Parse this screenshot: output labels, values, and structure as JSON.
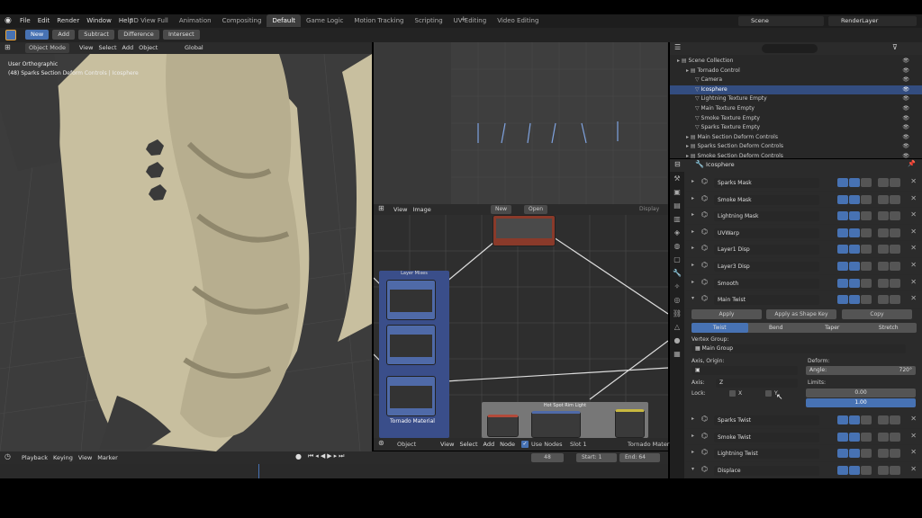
{
  "topbar": {
    "menus": [
      "File",
      "Edit",
      "Render",
      "Window",
      "Help"
    ],
    "workspaces": [
      "3D View Full",
      "Animation",
      "Compositing",
      "Default",
      "Game Logic",
      "Motion Tracking",
      "Scripting",
      "UV Editing",
      "Video Editing"
    ],
    "active_workspace": "Default",
    "scene": "Scene",
    "render_layer": "RenderLayer"
  },
  "toolbar": {
    "new": "New",
    "add": "Add",
    "subtract": "Subtract",
    "difference": "Difference",
    "intersect": "Intersect"
  },
  "viewport": {
    "mode": "Object Mode",
    "menus": [
      "View",
      "Select",
      "Add",
      "Object"
    ],
    "transform": "Global",
    "overlay_line1": "User Orthographic",
    "overlay_line2": "(48) Sparks Section Deform Controls | Icosphere"
  },
  "image_editor": {
    "menus": [
      "View",
      "Image"
    ],
    "new": "New",
    "open": "Open",
    "display": "Display"
  },
  "node_editor": {
    "object": "Object",
    "menus": [
      "View",
      "Select",
      "Add",
      "Node"
    ],
    "use_nodes": "Use Nodes",
    "slot": "Slot 1",
    "material": "Tornado Material",
    "frame_label": "Layer Mixes",
    "frame_label2": "Tornado Material",
    "frame_label3": "Hot Spot Rim Light"
  },
  "timeline": {
    "menus": [
      "Playback",
      "Keying",
      "View",
      "Marker"
    ],
    "frame": "48",
    "start_label": "Start:",
    "start": "1",
    "end_label": "End:",
    "end": "64"
  },
  "outliner": {
    "rows": [
      {
        "label": "Scene Collection",
        "indent": 0,
        "sel": false
      },
      {
        "label": "Tornado Control",
        "indent": 1,
        "sel": false
      },
      {
        "label": "Camera",
        "indent": 2,
        "sel": false
      },
      {
        "label": "Icosphere",
        "indent": 2,
        "sel": true
      },
      {
        "label": "Lightning Texture Empty",
        "indent": 2,
        "sel": false
      },
      {
        "label": "Main Texture Empty",
        "indent": 2,
        "sel": false
      },
      {
        "label": "Smoke Texture Empty",
        "indent": 2,
        "sel": false
      },
      {
        "label": "Sparks Texture Empty",
        "indent": 2,
        "sel": false
      },
      {
        "label": "Main Section Deform Controls",
        "indent": 1,
        "sel": false
      },
      {
        "label": "Sparks Section Deform Controls",
        "indent": 1,
        "sel": false
      },
      {
        "label": "Smoke Section Deform Controls",
        "indent": 1,
        "sel": false
      }
    ]
  },
  "properties": {
    "object": "Icosphere",
    "modifiers_top": [
      "Sparks Mask",
      "Smoke Mask",
      "Lightning Mask",
      "UVWarp",
      "Layer1 Disp",
      "Layer3 Disp",
      "Smooth",
      "Main Twist"
    ],
    "apply": "Apply",
    "apply_shape": "Apply as Shape Key",
    "copy": "Copy",
    "deform_tabs": [
      "Twist",
      "Bend",
      "Taper",
      "Stretch"
    ],
    "vertex_group_label": "Vertex Group:",
    "vertex_group": "Main Group",
    "axis_origin": "Axis, Origin:",
    "deform_label": "Deform:",
    "angle": "Angle:",
    "angle_value": "720°",
    "axis_label": "Axis:",
    "axis_value": "Z",
    "limits": "Limits:",
    "lim1": "0.00",
    "lim2": "1.00",
    "lock_label": "Lock:",
    "lock_x": "X",
    "lock_y": "Y",
    "modifiers_bottom": [
      "Sparks Twist",
      "Smoke Twist",
      "Lightning Twist",
      "Displace"
    ]
  }
}
